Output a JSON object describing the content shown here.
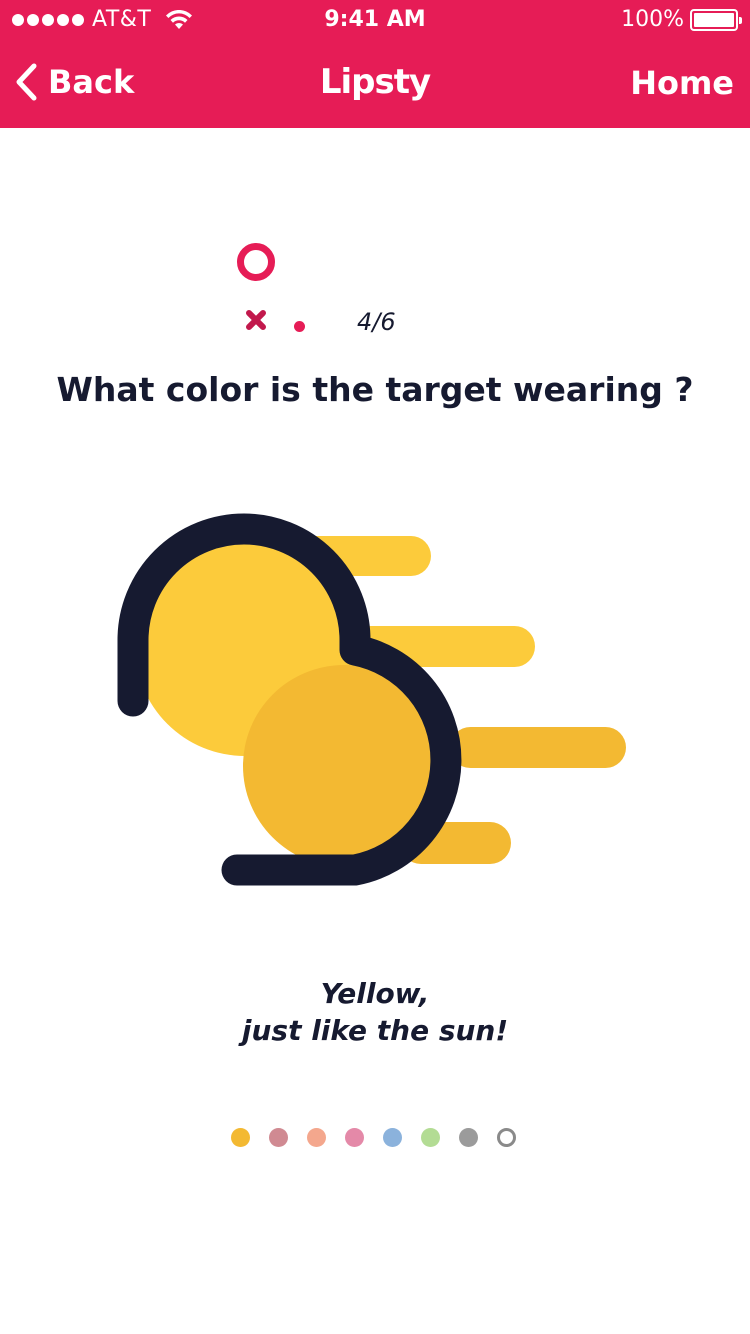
{
  "status_bar": {
    "carrier": "AT&T",
    "time": "9:41 AM",
    "battery": "100%",
    "battery_level": 1.0
  },
  "nav": {
    "back_label": "Back",
    "brand": "Lipsty",
    "home_label": "Home"
  },
  "quiz": {
    "step": "4/6",
    "question": "What color is the target wearing ?",
    "answer_line1": "Yellow,",
    "answer_line2": "just like the sun!"
  },
  "colors": {
    "accent": "#e61c56",
    "dark": "#161a30",
    "illustration_light": "#fccb3b",
    "illustration_dark": "#f3b932"
  },
  "color_options": [
    {
      "name": "yellow",
      "color": "#f3b932",
      "selected": true
    },
    {
      "name": "mauve",
      "color": "#d08a92",
      "selected": false
    },
    {
      "name": "peach",
      "color": "#f4a78d",
      "selected": false
    },
    {
      "name": "pink",
      "color": "#e489a8",
      "selected": false
    },
    {
      "name": "blue",
      "color": "#8bb2dc",
      "selected": false
    },
    {
      "name": "green",
      "color": "#b3dc94",
      "selected": false
    },
    {
      "name": "gray",
      "color": "#9b9b9b",
      "selected": false
    },
    {
      "name": "empty",
      "color": "",
      "selected": false
    }
  ]
}
